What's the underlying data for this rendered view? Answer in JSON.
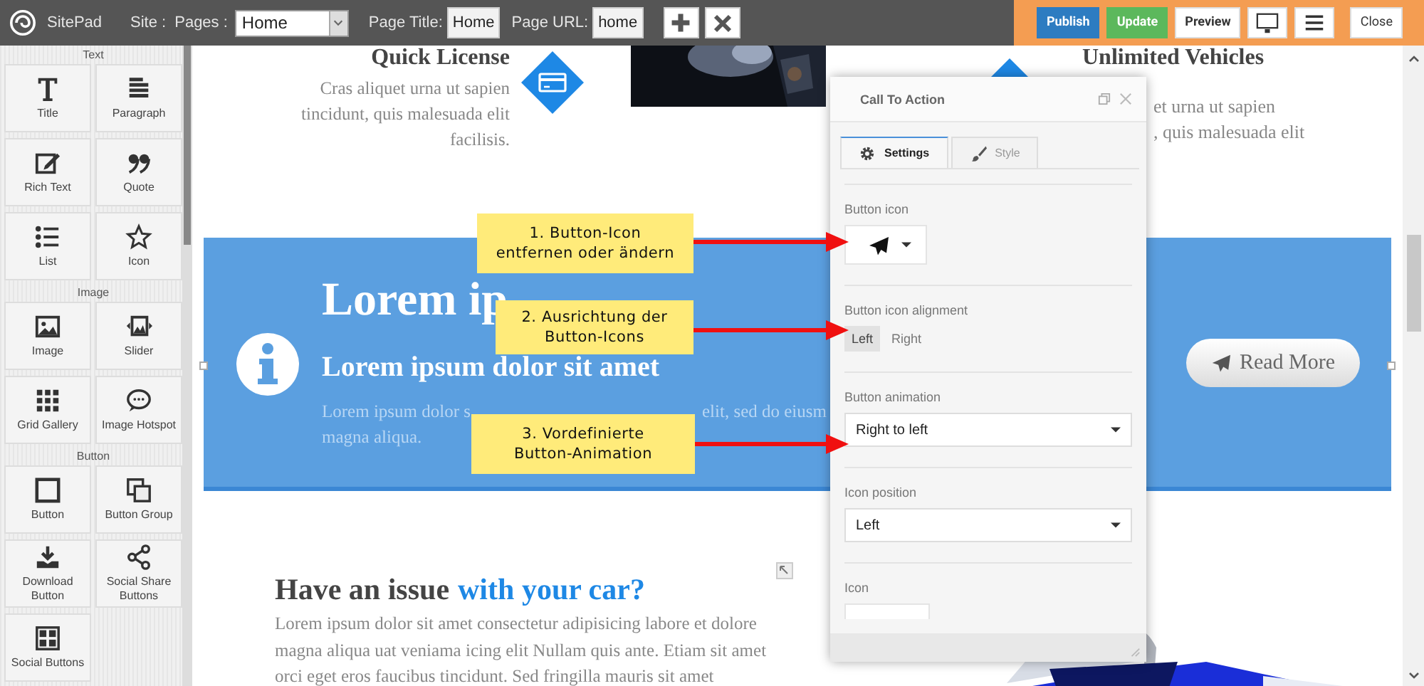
{
  "topbar": {
    "logo_text": "SitePad",
    "site_label": "Site :",
    "pages_label": "Pages :",
    "pages_select": {
      "value": "Home"
    },
    "page_title_label": "Page Title:",
    "page_title_input": {
      "value": "Home"
    },
    "page_url_label": "Page URL:",
    "page_url_input": {
      "value": "home"
    },
    "actions": [
      {
        "kind": "primary",
        "label": "Publish"
      },
      {
        "kind": "success",
        "label": "Update"
      },
      {
        "kind": "plain",
        "label": "Preview"
      },
      {
        "kind": "monitor"
      },
      {
        "kind": "menu"
      },
      {
        "kind": "close",
        "label": "Close"
      }
    ]
  },
  "sidebar": {
    "groups": [
      {
        "title": "Text",
        "items": [
          {
            "label": "Title"
          },
          {
            "label": "Paragraph"
          },
          {
            "label": "Rich Text"
          },
          {
            "label": "Quote"
          },
          {
            "label": "List"
          },
          {
            "label": "Icon"
          }
        ]
      },
      {
        "title": "Image",
        "items": [
          {
            "label": "Image"
          },
          {
            "label": "Slider"
          },
          {
            "label": "Grid Gallery"
          },
          {
            "label": "Image Hotspot"
          }
        ]
      },
      {
        "title": "Button",
        "items": [
          {
            "label": "Button"
          },
          {
            "label": "Button Group"
          },
          {
            "label": "Download Button"
          },
          {
            "label": "Social Share Buttons"
          },
          {
            "label": "Social Buttons"
          }
        ]
      }
    ]
  },
  "canvas": {
    "features": [
      {
        "title": "Quick License",
        "lines": [
          "Cras aliquet urna ut sapien",
          "tincidunt, quis malesuada elit",
          "facilisis."
        ]
      },
      {
        "title": "Unlimited Vehicles",
        "lines": [
          "et urna ut sapien",
          ", quis malesuada elit"
        ]
      }
    ],
    "cta": {
      "heading": "Lorem ip",
      "subheading": "Lorem ipsum dolor sit amet",
      "text_parts": [
        "Lorem ipsum dolor s",
        "elit, sed do eiusm",
        "magna aliqua."
      ],
      "button": {
        "label": "Read More"
      }
    },
    "issue": {
      "title_parts": [
        {
          "text": "Have an issue",
          "accent": false
        },
        {
          "text": "with your car?",
          "accent": true
        }
      ],
      "body": "Lorem ipsum dolor sit amet consectetur adipisicing labore et dolore magna aliqua uat veniama icing elit Nullam quis ante. Etiam sit amet orci eget eros faucibus tincidunt. Sed fringilla mauris sit amet"
    }
  },
  "dialog": {
    "title": "Call To Action",
    "tabs": [
      {
        "label": "Settings",
        "selected": true
      },
      {
        "label": "Style",
        "selected": false
      }
    ],
    "fields": [
      {
        "kind": "icon_picker",
        "label": "Button icon"
      },
      {
        "kind": "segmented",
        "label": "Button icon alignment",
        "options": [
          {
            "label": "Left",
            "selected": true
          },
          {
            "label": "Right",
            "selected": false
          }
        ]
      },
      {
        "kind": "select",
        "label": "Button animation",
        "value": "Right to left"
      },
      {
        "kind": "select",
        "label": "Icon position",
        "value": "Left"
      },
      {
        "kind": "partial",
        "label": "Icon"
      }
    ]
  },
  "callouts": [
    {
      "lines": [
        "1. Button-Icon",
        "entfernen oder ändern"
      ]
    },
    {
      "lines": [
        "2. Ausrichtung der",
        "Button-Icons"
      ]
    },
    {
      "lines": [
        "3. Vordefinierte",
        "Button-Animation"
      ]
    }
  ]
}
